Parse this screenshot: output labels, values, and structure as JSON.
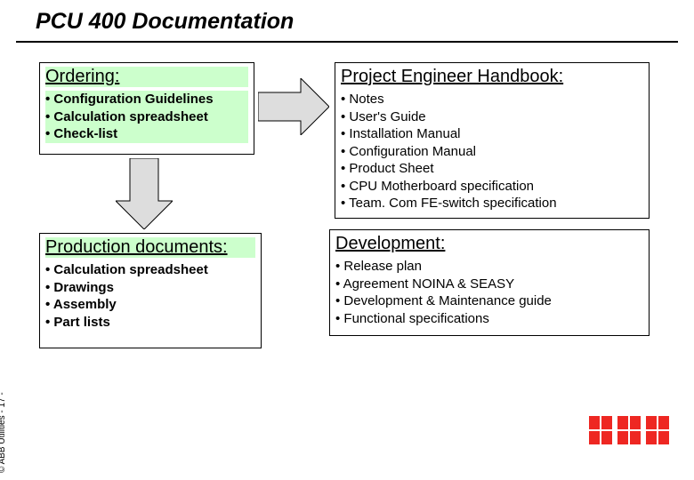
{
  "title": "PCU 400 Documentation",
  "copyright": "© ABB Utilities  - 17 -",
  "logo_name": "ABB",
  "ordering": {
    "title": "Ordering:",
    "items": [
      "Configuration Guidelines",
      "Calculation spreadsheet",
      "Check-list"
    ]
  },
  "project": {
    "title": "Project Engineer Handbook:",
    "items": [
      "Notes",
      "User's Guide",
      "Installation Manual",
      "Configuration Manual",
      "Product Sheet",
      "CPU Motherboard specification",
      "Team. Com FE-switch specification"
    ]
  },
  "production": {
    "title": "Production documents:",
    "items": [
      "Calculation spreadsheet",
      "Drawings",
      "Assembly",
      "Part lists"
    ]
  },
  "development": {
    "title": "Development:",
    "items": [
      "Release plan",
      "Agreement NOINA & SEASY",
      "Development & Maintenance guide",
      "Functional specifications"
    ]
  }
}
